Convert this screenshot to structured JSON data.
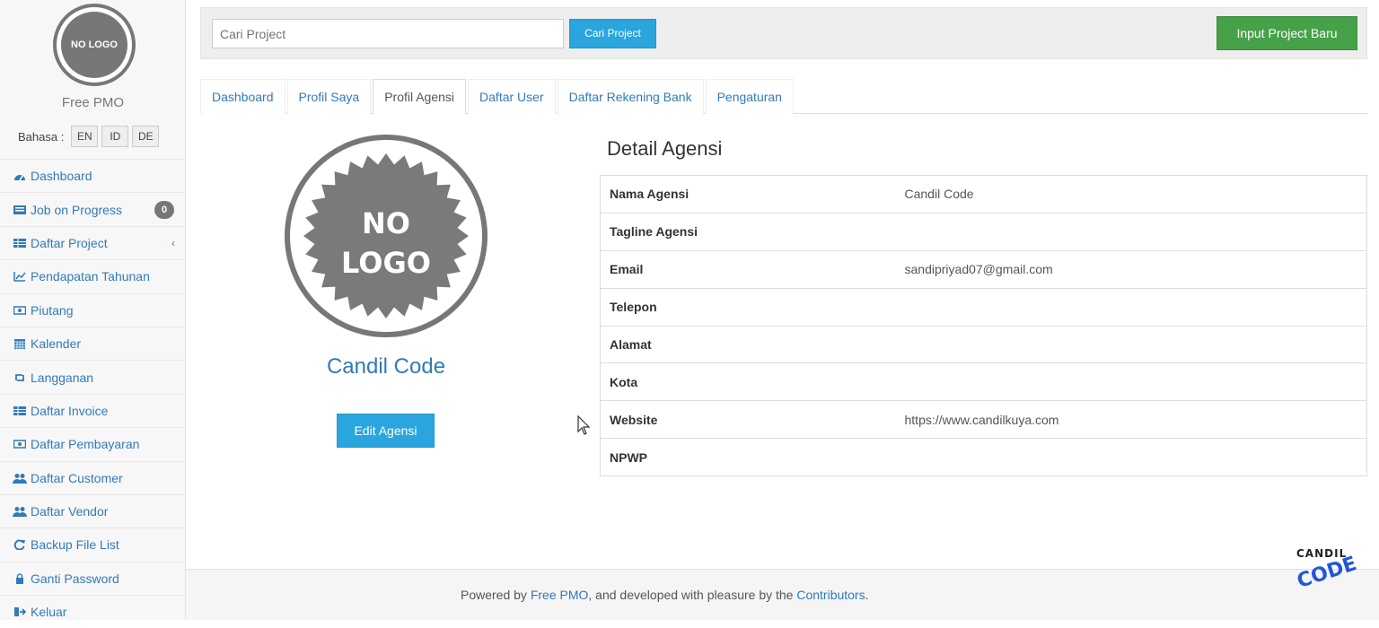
{
  "sidebar": {
    "logo_text": "NO LOGO",
    "brand": "Free PMO",
    "language_label": "Bahasa :",
    "languages": [
      "EN",
      "ID",
      "DE"
    ],
    "items": [
      {
        "label": "Dashboard",
        "icon": "dashboard-icon"
      },
      {
        "label": "Job on Progress",
        "icon": "list-icon",
        "badge": "0"
      },
      {
        "label": "Daftar Project",
        "icon": "table-icon"
      },
      {
        "label": "Pendapatan Tahunan",
        "icon": "line-chart-icon"
      },
      {
        "label": "Piutang",
        "icon": "money-icon"
      },
      {
        "label": "Kalender",
        "icon": "calendar-icon"
      },
      {
        "label": "Langganan",
        "icon": "retweet-icon"
      },
      {
        "label": "Daftar Invoice",
        "icon": "table-icon"
      },
      {
        "label": "Daftar Pembayaran",
        "icon": "money-icon"
      },
      {
        "label": "Daftar Customer",
        "icon": "users-icon"
      },
      {
        "label": "Daftar Vendor",
        "icon": "users-icon"
      },
      {
        "label": "Backup File List",
        "icon": "refresh-icon"
      },
      {
        "label": "Ganti Password",
        "icon": "lock-icon"
      },
      {
        "label": "Keluar",
        "icon": "sign-out-icon"
      }
    ]
  },
  "topbar": {
    "search_placeholder": "Cari Project",
    "search_button": "Cari Project",
    "new_project_button": "Input Project Baru"
  },
  "tabs": [
    {
      "label": "Dashboard",
      "active": false
    },
    {
      "label": "Profil Saya",
      "active": false
    },
    {
      "label": "Profil Agensi",
      "active": true
    },
    {
      "label": "Daftar User",
      "active": false
    },
    {
      "label": "Daftar Rekening Bank",
      "active": false
    },
    {
      "label": "Pengaturan",
      "active": false
    }
  ],
  "profile": {
    "logo_line1": "NO",
    "logo_line2": "LOGO",
    "agency_name": "Candil Code",
    "edit_button": "Edit Agensi"
  },
  "detail": {
    "title": "Detail Agensi",
    "rows": [
      {
        "key": "Nama Agensi",
        "value": "Candil Code"
      },
      {
        "key": "Tagline Agensi",
        "value": ""
      },
      {
        "key": "Email",
        "value": "sandipriyad07@gmail.com"
      },
      {
        "key": "Telepon",
        "value": ""
      },
      {
        "key": "Alamat",
        "value": ""
      },
      {
        "key": "Kota",
        "value": ""
      },
      {
        "key": "Website",
        "value": "https://www.candilkuya.com"
      },
      {
        "key": "NPWP",
        "value": ""
      }
    ]
  },
  "footer": {
    "prefix": "Powered by ",
    "link1": "Free PMO",
    "middle": ", and developed with pleasure by the ",
    "link2": "Contributors",
    "suffix": "."
  },
  "watermark": {
    "line1": "CANDIL",
    "line2": "CODE"
  },
  "colors": {
    "link": "#337ab7",
    "primary_button": "#2aa5dd",
    "success_button": "#46a149"
  }
}
